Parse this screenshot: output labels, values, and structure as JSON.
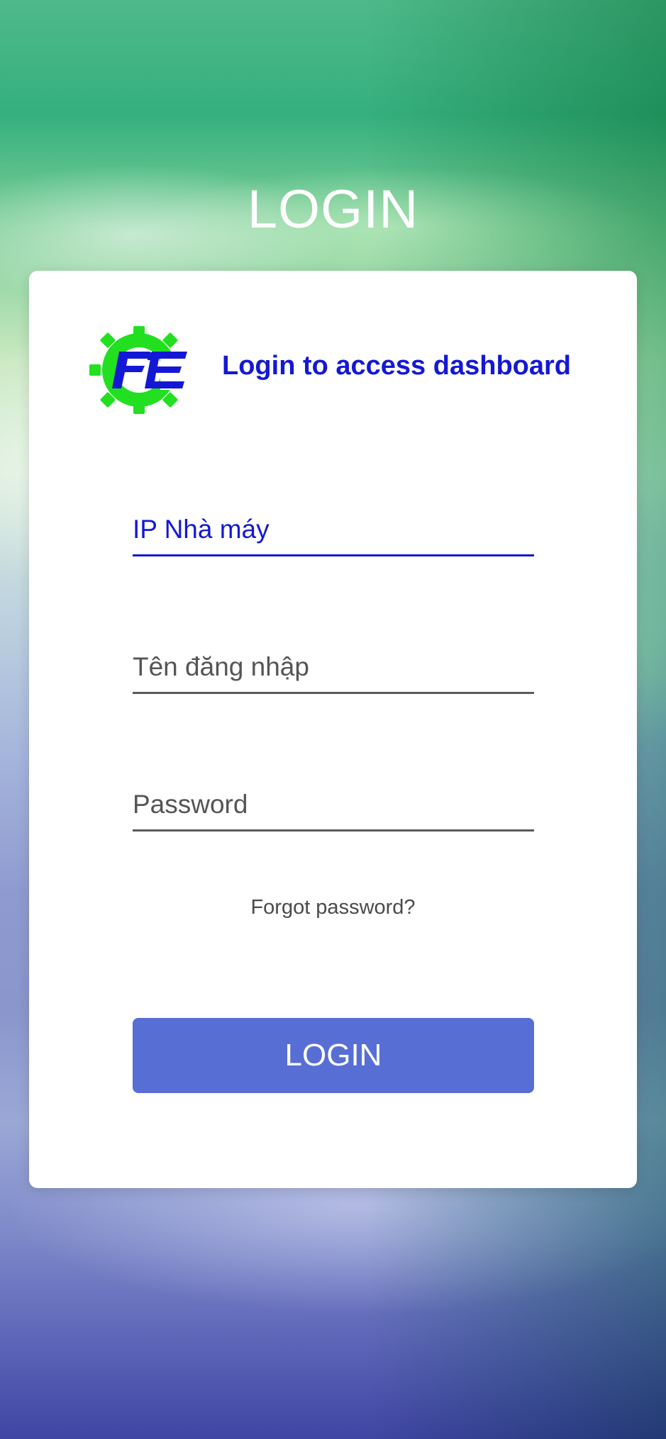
{
  "page": {
    "title": "LOGIN"
  },
  "card": {
    "tagline": "Login to access dashboard",
    "logo_icon": "gear-logo-icon"
  },
  "form": {
    "fields": [
      {
        "placeholder": "IP Nhà máy",
        "value": ""
      },
      {
        "placeholder": "Tên đăng nhập",
        "value": ""
      },
      {
        "placeholder": "Password",
        "value": ""
      }
    ],
    "forgot_password_label": "Forgot password?",
    "login_button_label": "LOGIN"
  },
  "colors": {
    "accent": "#1418d4",
    "button": "#576ed5",
    "logo_green": "#22e020"
  }
}
